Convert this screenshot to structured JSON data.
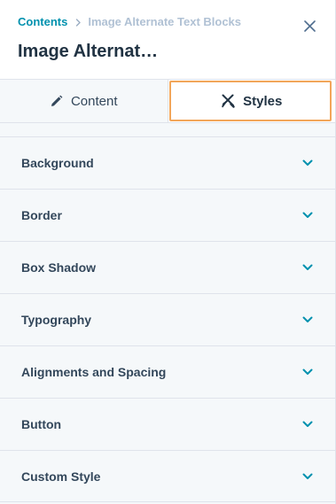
{
  "header": {
    "breadcrumb": {
      "root_label": "Contents",
      "current_label": "Image Alternate Text Blocks"
    },
    "title": "Image Alternat…",
    "close_icon": "close-icon"
  },
  "tabs": [
    {
      "label": "Content",
      "icon": "pencil-icon",
      "active": false
    },
    {
      "label": "Styles",
      "icon": "styles-icon",
      "active": true
    }
  ],
  "sections": [
    {
      "label": "Background",
      "icon": "chevron-down-icon"
    },
    {
      "label": "Border",
      "icon": "chevron-down-icon"
    },
    {
      "label": "Box Shadow",
      "icon": "chevron-down-icon"
    },
    {
      "label": "Typography",
      "icon": "chevron-down-icon"
    },
    {
      "label": "Alignments and Spacing",
      "icon": "chevron-down-icon"
    },
    {
      "label": "Button",
      "icon": "chevron-down-icon"
    },
    {
      "label": "Custom Style",
      "icon": "chevron-down-icon"
    }
  ],
  "colors": {
    "link": "#0091ae",
    "breadcrumb_current": "#b0c1d4",
    "title": "#213343",
    "text": "#33475b",
    "panel_bg": "#f5f8fa",
    "border": "#dfe3eb",
    "active_tab_outline": "#f2a65a",
    "chevron": "#0091ae"
  }
}
